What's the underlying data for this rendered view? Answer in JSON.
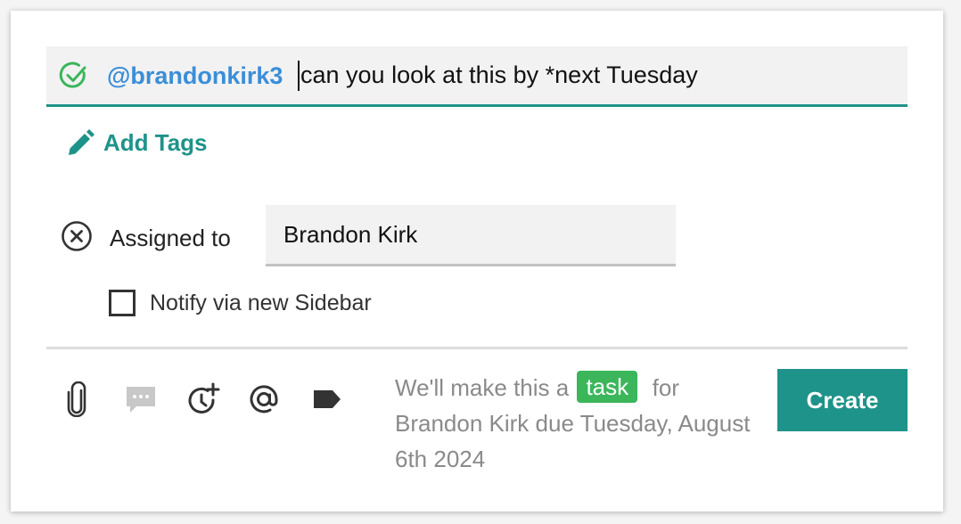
{
  "composer": {
    "mention": "@brandonkirk3",
    "message": "can you look at this by *next Tuesday"
  },
  "tags": {
    "add_label": "Add Tags"
  },
  "assignment": {
    "label": "Assigned to",
    "assignee": "Brandon Kirk"
  },
  "notify": {
    "label": "Notify via new Sidebar",
    "checked": false
  },
  "toolbar": {
    "icons": [
      "paperclip-icon",
      "comment-icon",
      "reminder-icon",
      "mention-icon",
      "tag-icon"
    ]
  },
  "summary": {
    "prefix": "We'll make this a",
    "badge": "task",
    "suffix": "for Brandon Kirk due Tuesday, August 6th 2024"
  },
  "actions": {
    "create_label": "Create"
  },
  "colors": {
    "accent": "#1e9389",
    "mention": "#3a8ed8",
    "task_badge": "#3bb65a",
    "check": "#3bb65a"
  }
}
